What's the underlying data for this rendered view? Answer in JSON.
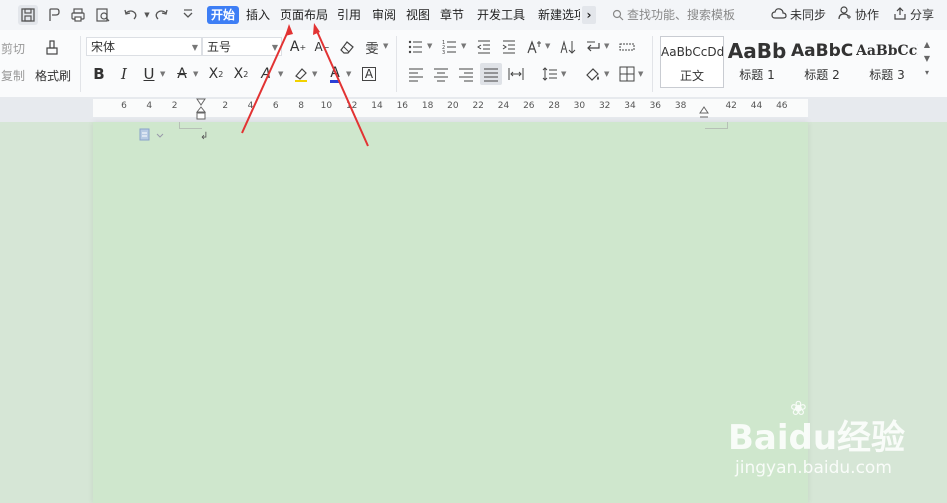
{
  "menu": {
    "tabs": [
      "开始",
      "插入",
      "页面布局",
      "引用",
      "审阅",
      "视图",
      "章节",
      "开发工具",
      "新建选项"
    ],
    "more": "›",
    "search_placeholder": "查找功能、搜索模板",
    "sync": "未同步",
    "collab": "协作",
    "share": "分享"
  },
  "ribbon": {
    "cut": "剪切",
    "copy": "复制",
    "format_painter": "格式刷",
    "font_name": "宋体",
    "font_size": "五号",
    "pinyin": "雯",
    "styles": [
      {
        "sample": "AaBbCcDd",
        "name": "正文"
      },
      {
        "sample": "AaBb",
        "name": "标题 1"
      },
      {
        "sample": "AaBbC",
        "name": "标题 2"
      },
      {
        "sample": "AaBbCcI",
        "name": "标题 3"
      }
    ]
  },
  "ruler": {
    "ticks": [
      "6",
      "4",
      "2",
      "",
      "2",
      "4",
      "6",
      "8",
      "10",
      "12",
      "14",
      "16",
      "18",
      "20",
      "22",
      "24",
      "26",
      "28",
      "30",
      "32",
      "34",
      "36",
      "38",
      "",
      "42",
      "44",
      "46"
    ]
  },
  "watermark": {
    "logo": "Baidu经验",
    "url": "jingyan.baidu.com"
  },
  "colors": {
    "accent": "#3d7ef5",
    "page": "#cfe7cd",
    "annotation": "#e23333"
  }
}
